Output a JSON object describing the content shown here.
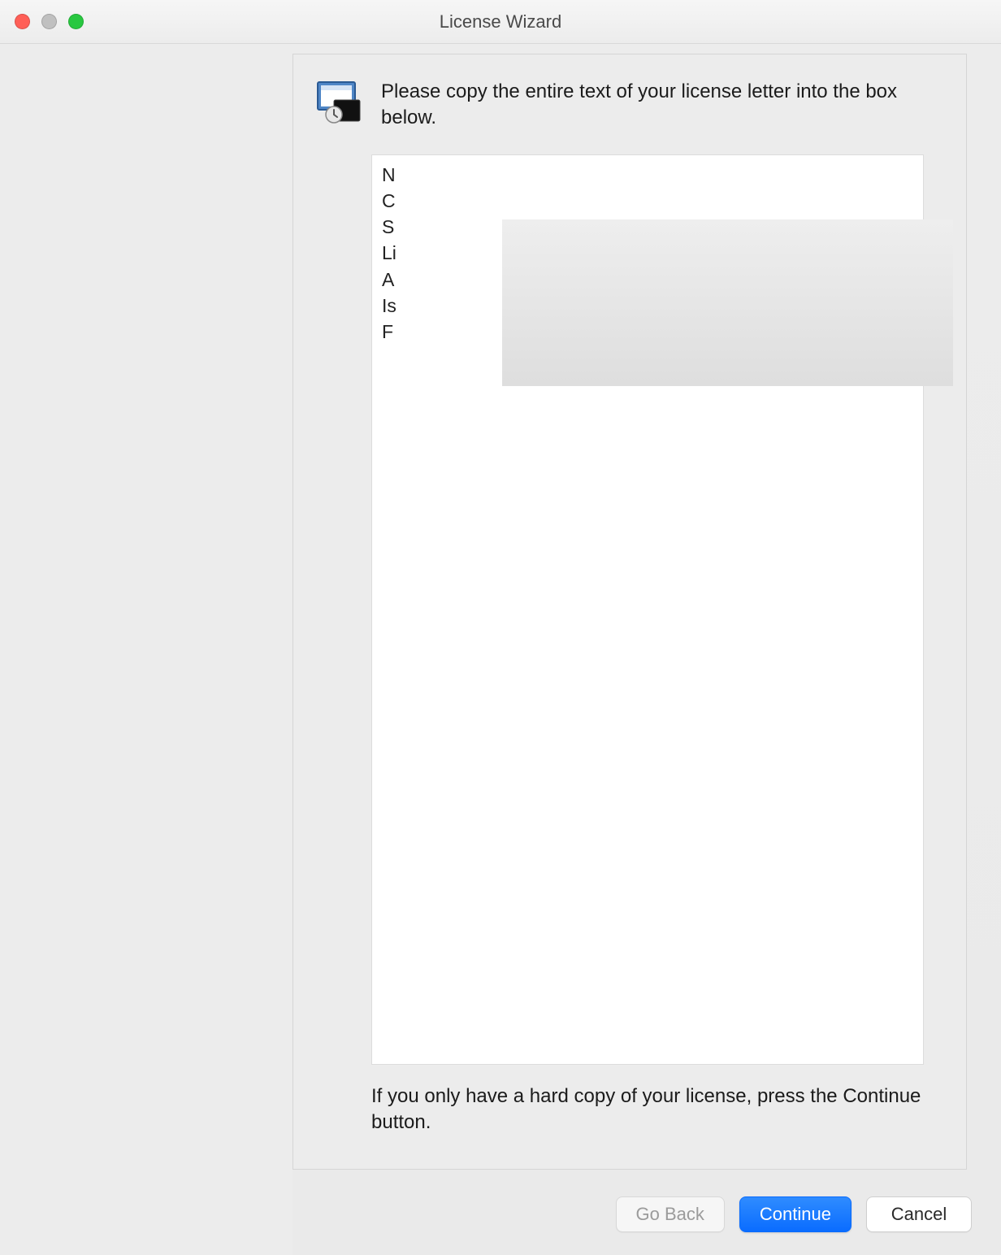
{
  "window": {
    "title": "License Wizard"
  },
  "content": {
    "instruction": "Please copy the entire text of your license letter into the box below.",
    "license_text": "N\nC\nS\nLi\nA\nIs\nF",
    "footer_note": "If you only have a hard copy of your license, press the Continue button."
  },
  "buttons": {
    "go_back": "Go Back",
    "continue": "Continue",
    "cancel": "Cancel"
  }
}
